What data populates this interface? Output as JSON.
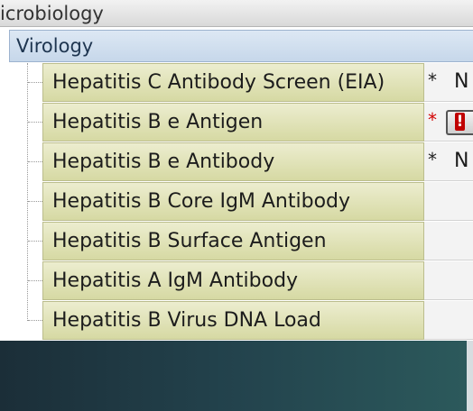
{
  "header": {
    "title": "icrobiology"
  },
  "group": {
    "label": "Virology"
  },
  "rows": [
    {
      "name": "Hepatitis C Antibody Screen (EIA)",
      "marker": "*",
      "marker_color": "#222222",
      "value": "N"
    },
    {
      "name": "Hepatitis B e Antigen",
      "marker": "*",
      "marker_color": "#d20000",
      "value": "",
      "icon": "alert-icon",
      "icon_glyph": "!"
    },
    {
      "name": "Hepatitis B e Antibody",
      "marker": "*",
      "marker_color": "#222222",
      "value": "N"
    },
    {
      "name": "Hepatitis B Core IgM Antibody",
      "marker": "",
      "value": ""
    },
    {
      "name": "Hepatitis B Surface Antigen",
      "marker": "",
      "value": ""
    },
    {
      "name": "Hepatitis A IgM Antibody",
      "marker": "",
      "value": ""
    },
    {
      "name": "Hepatitis B Virus DNA Load",
      "marker": "",
      "value": ""
    }
  ]
}
